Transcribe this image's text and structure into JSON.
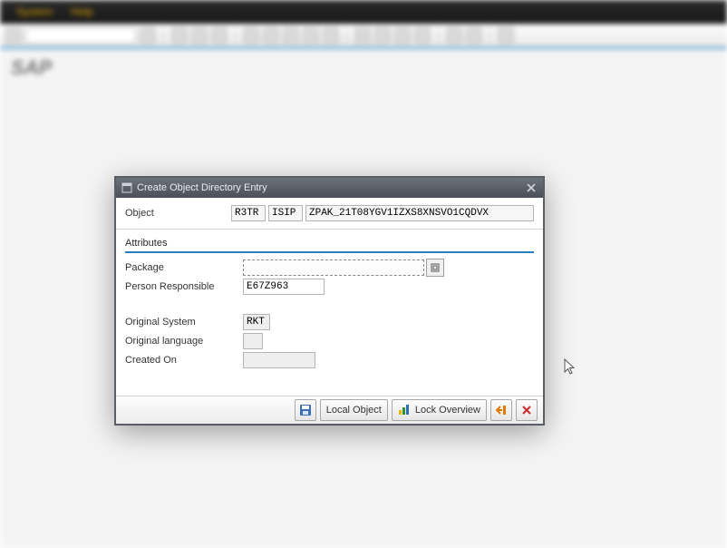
{
  "menubar": {
    "item1": "System",
    "item2": "Help"
  },
  "header_logo": "SAP",
  "dialog": {
    "title": "Create Object Directory Entry",
    "object_label": "Object",
    "pgmid": "R3TR",
    "objtype": "ISIP",
    "objname": "ZPAK_21T08YGV1IZXS8XNSVO1CQDVX",
    "section_attributes": "Attributes",
    "package_label": "Package",
    "package_value": "",
    "responsible_label": "Person Responsible",
    "responsible_value": "E67Z963",
    "orig_system_label": "Original System",
    "orig_system_value": "RKT",
    "orig_lang_label": "Original language",
    "orig_lang_value": "",
    "created_on_label": "Created On",
    "created_on_value": "",
    "btn_local_object": "Local Object",
    "btn_lock_overview": "Lock Overview"
  }
}
